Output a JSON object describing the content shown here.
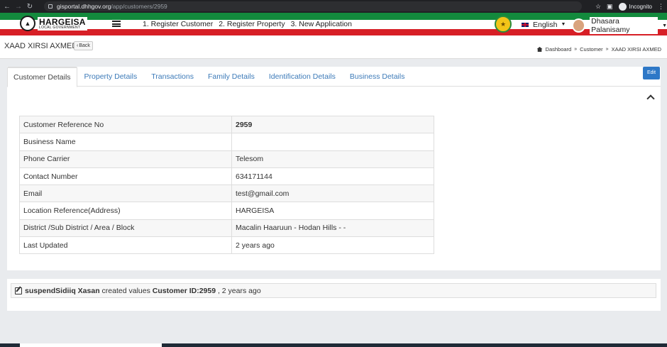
{
  "browser": {
    "url_host": "gisportal.dhhgov.org",
    "url_path": "/app/customers/2959",
    "incognito_label": "Incognito"
  },
  "header": {
    "logo_main": "HARGEISA",
    "logo_sub": "LOCAL GOVERNMENT",
    "menu": [
      {
        "label": "1. Register Customer"
      },
      {
        "label": "2. Register Property"
      },
      {
        "label": "3. New Application"
      }
    ],
    "language": "English",
    "user_name": "Dhasara Palanisamy"
  },
  "page": {
    "title": "XAAD XIRSI AXMED",
    "back_label": "Back",
    "breadcrumb": [
      "Dashboard",
      "Customer",
      "XAAD XIRSI AXMED"
    ]
  },
  "tabs": [
    {
      "label": "Customer Details",
      "active": true
    },
    {
      "label": "Property Details"
    },
    {
      "label": "Transactions"
    },
    {
      "label": "Family Details"
    },
    {
      "label": "Identification Details"
    },
    {
      "label": "Business Details"
    }
  ],
  "edit_label": "Edit",
  "details": [
    {
      "label": "Customer Reference No",
      "value": "2959"
    },
    {
      "label": "Business Name",
      "value": ""
    },
    {
      "label": "Phone Carrier",
      "value": "Telesom"
    },
    {
      "label": "Contact Number",
      "value": "634171144"
    },
    {
      "label": "Email",
      "value": "test@gmail.com"
    },
    {
      "label": "Location Reference(Address)",
      "value": "HARGEISA"
    },
    {
      "label": "District /Sub District / Area / Block",
      "value": "Macalin Haaruun - Hodan Hills - -"
    },
    {
      "label": "Last Updated",
      "value": "2 years ago"
    }
  ],
  "activity": {
    "actor": "suspendSidiiq Xasan",
    "action": "created values",
    "subject": "Customer ID:2959",
    "time": ", 2 years ago"
  }
}
